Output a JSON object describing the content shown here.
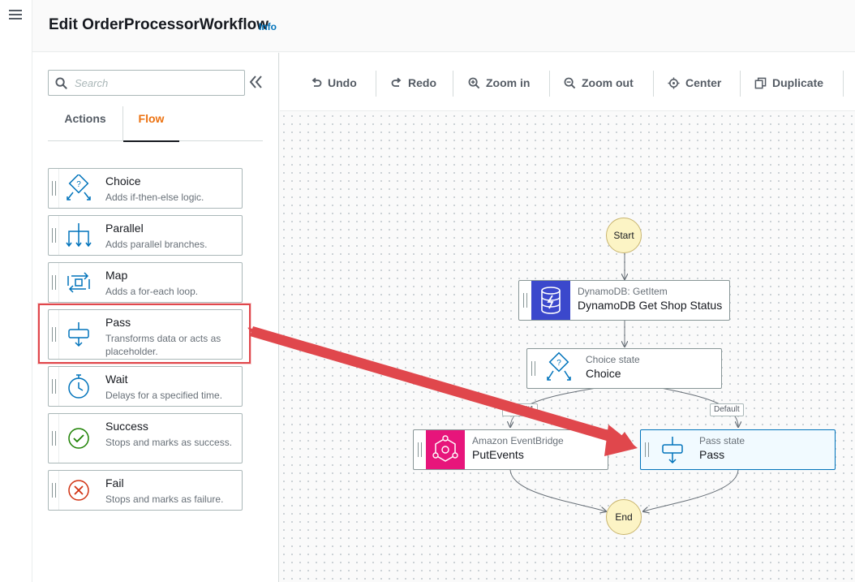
{
  "page": {
    "title": "Edit OrderProcessorWorkflow",
    "info_link": "Info"
  },
  "search": {
    "placeholder": "Search"
  },
  "tabs": [
    {
      "label": "Actions"
    },
    {
      "label": "Flow"
    }
  ],
  "flow_states": [
    {
      "name": "Choice",
      "description": "Adds if-then-else logic.",
      "icon": "choice-icon"
    },
    {
      "name": "Parallel",
      "description": "Adds parallel branches.",
      "icon": "parallel-icon"
    },
    {
      "name": "Map",
      "description": "Adds a for-each loop.",
      "icon": "map-icon"
    },
    {
      "name": "Pass",
      "description": "Transforms data or acts as placeholder.",
      "icon": "pass-icon"
    },
    {
      "name": "Wait",
      "description": "Delays for a specified time.",
      "icon": "wait-icon"
    },
    {
      "name": "Success",
      "description": "Stops and marks as success.",
      "icon": "success-icon"
    },
    {
      "name": "Fail",
      "description": "Stops and marks as failure.",
      "icon": "fail-icon"
    }
  ],
  "toolbar": {
    "undo": "Undo",
    "redo": "Redo",
    "zoom_in": "Zoom in",
    "zoom_out": "Zoom out",
    "center": "Center",
    "duplicate": "Duplicate"
  },
  "workflow": {
    "start": "Start",
    "end": "End",
    "nodes": {
      "dynamodb": {
        "type": "DynamoDB: GetItem",
        "title": "DynamoDB Get Shop Status",
        "color": "#3b48cc"
      },
      "choice": {
        "type": "Choice state",
        "title": "Choice"
      },
      "eventbridge": {
        "type": "Amazon EventBridge",
        "title": "PutEvents",
        "color": "#e7157b"
      },
      "pass": {
        "type": "Pass state",
        "title": "Pass",
        "selected": true
      }
    },
    "edge_labels": {
      "rule": "Rule #1",
      "default": "Default"
    }
  },
  "colors": {
    "accent": "#ec7211",
    "link": "#0073bb",
    "annotation": "#e0474c"
  }
}
